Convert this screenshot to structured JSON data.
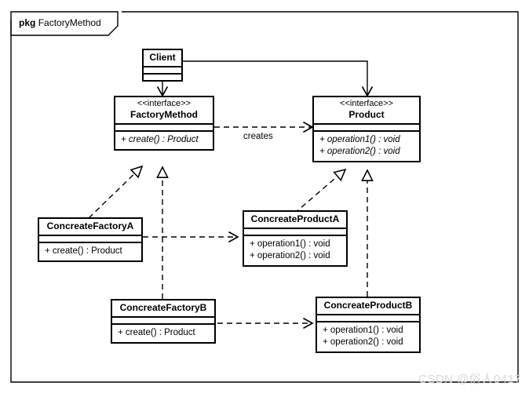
{
  "package": {
    "keyword": "pkg",
    "name": "FactoryMethod"
  },
  "classes": {
    "client": {
      "name": "Client",
      "stereotype": "",
      "members": []
    },
    "factory_method": {
      "name": "FactoryMethod",
      "stereotype": "<<interface>>",
      "members": [
        "+ create() : Product"
      ]
    },
    "product": {
      "name": "Product",
      "stereotype": "<<interface>>",
      "members": [
        "+ operation1() : void",
        "+ operation2() : void"
      ]
    },
    "concreate_factory_a": {
      "name": "ConcreateFactoryA",
      "stereotype": "",
      "members": [
        "+ create() : Product"
      ]
    },
    "concreate_factory_b": {
      "name": "ConcreateFactoryB",
      "stereotype": "",
      "members": [
        "+ create() : Product"
      ]
    },
    "concreate_product_a": {
      "name": "ConcreateProductA",
      "stereotype": "",
      "members": [
        "+ operation1() : void",
        "+ operation2() : void"
      ]
    },
    "concreate_product_b": {
      "name": "ConcreateProductB",
      "stereotype": "",
      "members": [
        "+ operation1() : void",
        "+ operation2() : void"
      ]
    }
  },
  "edges": {
    "creates_label": "creates"
  },
  "watermark": {
    "text": "CSDN @俗人0417"
  },
  "colors": {
    "stroke": "#000000",
    "background": "#ffffff",
    "watermark": "#d8d8d8"
  }
}
